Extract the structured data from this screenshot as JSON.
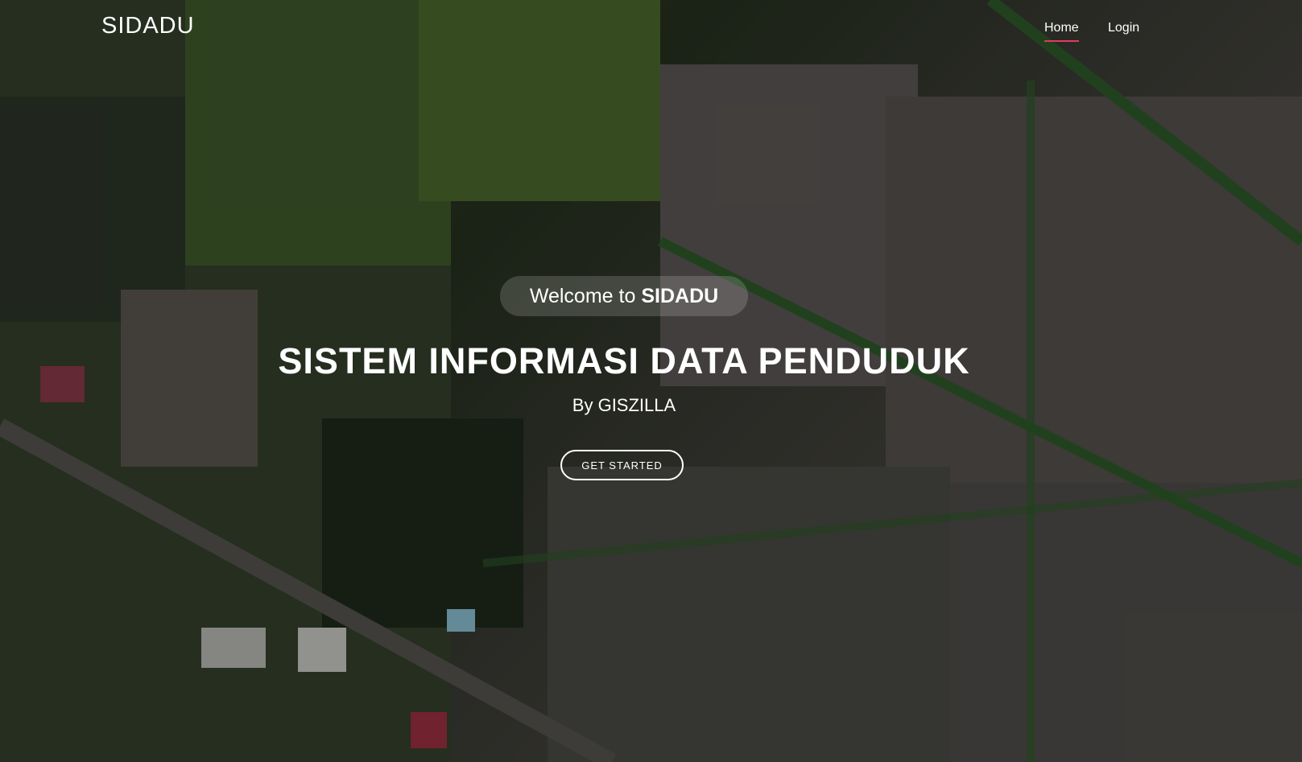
{
  "navbar": {
    "logo": "SIDADU",
    "links": [
      {
        "label": "Home",
        "active": true
      },
      {
        "label": "Login",
        "active": false
      }
    ],
    "active_color": "#e23b5c"
  },
  "hero": {
    "welcome_prefix": "Welcome to",
    "welcome_brand": "SIDADU",
    "title": "SISTEM INFORMASI DATA PENDUDUK",
    "subtitle": "By GISZILLA",
    "cta_label": "GET STARTED",
    "background": "aerial-rice-field-photo"
  }
}
